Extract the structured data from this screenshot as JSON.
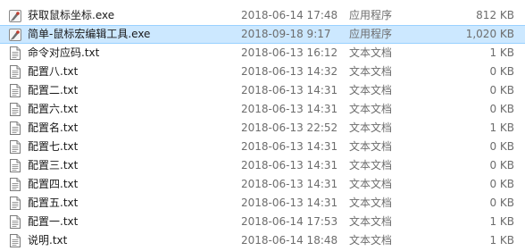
{
  "files": [
    {
      "name": "获取鼠标坐标.exe",
      "date": "2018-06-14 17:48",
      "type": "应用程序",
      "size": "812 KB",
      "icon": "exe-icon",
      "selected": false
    },
    {
      "name": "简单-鼠标宏编辑工具.exe",
      "date": "2018-09-18 9:17",
      "type": "应用程序",
      "size": "1,020 KB",
      "icon": "exe-icon",
      "selected": true
    },
    {
      "name": "命令对应码.txt",
      "date": "2018-06-13 16:12",
      "type": "文本文档",
      "size": "1 KB",
      "icon": "text-file-icon",
      "selected": false
    },
    {
      "name": "配置八.txt",
      "date": "2018-06-13 14:32",
      "type": "文本文档",
      "size": "0 KB",
      "icon": "text-file-icon",
      "selected": false
    },
    {
      "name": "配置二.txt",
      "date": "2018-06-13 14:31",
      "type": "文本文档",
      "size": "0 KB",
      "icon": "text-file-icon",
      "selected": false
    },
    {
      "name": "配置六.txt",
      "date": "2018-06-13 14:31",
      "type": "文本文档",
      "size": "0 KB",
      "icon": "text-file-icon",
      "selected": false
    },
    {
      "name": "配置名.txt",
      "date": "2018-06-13 22:52",
      "type": "文本文档",
      "size": "1 KB",
      "icon": "text-file-icon",
      "selected": false
    },
    {
      "name": "配置七.txt",
      "date": "2018-06-13 14:31",
      "type": "文本文档",
      "size": "0 KB",
      "icon": "text-file-icon",
      "selected": false
    },
    {
      "name": "配置三.txt",
      "date": "2018-06-13 14:31",
      "type": "文本文档",
      "size": "0 KB",
      "icon": "text-file-icon",
      "selected": false
    },
    {
      "name": "配置四.txt",
      "date": "2018-06-13 14:31",
      "type": "文本文档",
      "size": "0 KB",
      "icon": "text-file-icon",
      "selected": false
    },
    {
      "name": "配置五.txt",
      "date": "2018-06-13 14:31",
      "type": "文本文档",
      "size": "0 KB",
      "icon": "text-file-icon",
      "selected": false
    },
    {
      "name": "配置一.txt",
      "date": "2018-06-14 17:53",
      "type": "文本文档",
      "size": "1 KB",
      "icon": "text-file-icon",
      "selected": false
    },
    {
      "name": "说明.txt",
      "date": "2018-06-14 18:48",
      "type": "文本文档",
      "size": "1 KB",
      "icon": "text-file-icon",
      "selected": false
    }
  ],
  "colors": {
    "selected_background": "#cce8ff",
    "selected_border": "#99d1ff",
    "secondary_text": "#6d6d6d",
    "primary_text": "#1a1a1a"
  }
}
